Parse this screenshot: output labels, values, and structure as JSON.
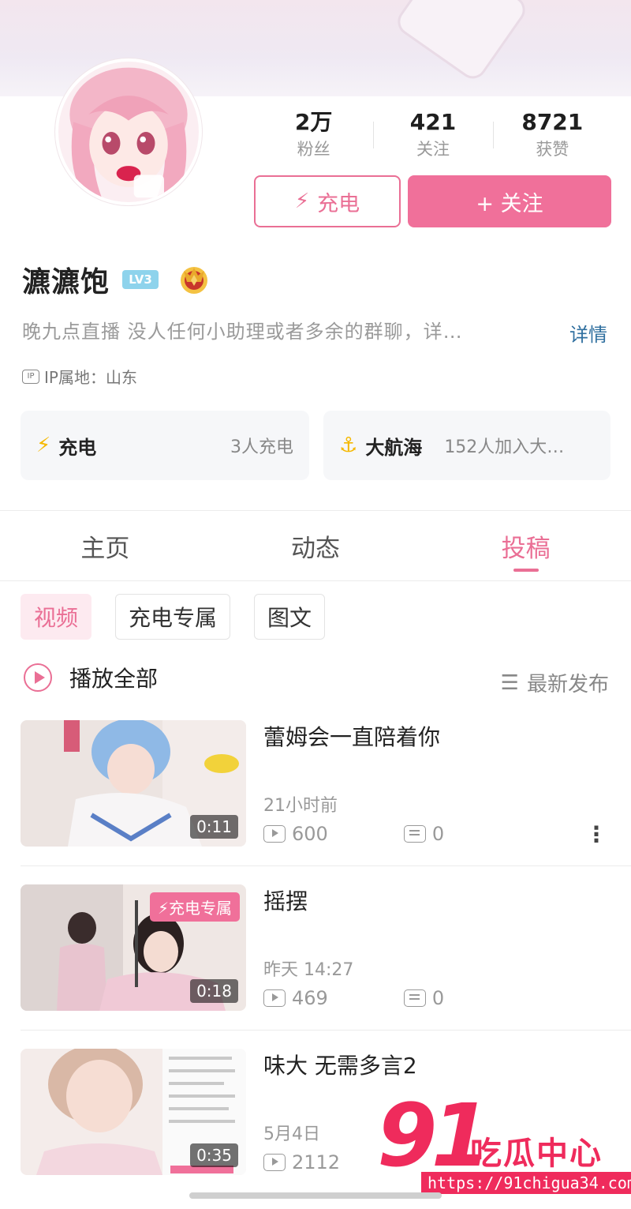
{
  "profile": {
    "name": "瀌瀌饱",
    "level": "LV3",
    "bio": "晚九点直播   没人任何小助理或者多余的群聊，详…",
    "bio_more": "详情",
    "ip_badge": "IP",
    "ip_location": "IP属地：山东"
  },
  "stats": [
    {
      "value": "2万",
      "label": "粉丝"
    },
    {
      "value": "421",
      "label": "关注"
    },
    {
      "value": "8721",
      "label": "获赞"
    }
  ],
  "actions": {
    "charge_icon": "bolt-icon",
    "charge_label": "充电",
    "follow_icon": "plus-icon",
    "follow_label": "+ 关注"
  },
  "cards": [
    {
      "icon": "bolt-icon",
      "title": "充电",
      "value": "3人充电"
    },
    {
      "icon": "anchor-icon",
      "title": "大航海",
      "value": "152人加入大…"
    }
  ],
  "tabs": [
    {
      "label": "主页",
      "active": false
    },
    {
      "label": "动态",
      "active": false
    },
    {
      "label": "投稿",
      "active": true
    }
  ],
  "filters": [
    {
      "label": "视频",
      "active": true
    },
    {
      "label": "充电专属",
      "active": false
    },
    {
      "label": "图文",
      "active": false
    }
  ],
  "list_header": {
    "play_all": "播放全部",
    "sort_label": "最新发布"
  },
  "videos": [
    {
      "title": "蕾姆会一直陪着你",
      "time": "21小时前",
      "plays": "600",
      "comments": "0",
      "duration": "0:11",
      "badge": ""
    },
    {
      "title": "摇摆",
      "time": "昨天 14:27",
      "plays": "469",
      "comments": "0",
      "duration": "0:18",
      "badge": "⚡充电专属"
    },
    {
      "title": "味大 无需多言2",
      "time": "5月4日",
      "plays": "2112",
      "comments": "",
      "duration": "0:35",
      "badge": ""
    }
  ],
  "watermark": {
    "number": "91",
    "text": "吃瓜中心",
    "url": "https://91chigua34.com"
  },
  "colors": {
    "accent": "#f0709a",
    "accent_text": "#ea6f95",
    "link": "#2f6f9f",
    "watermark": "#ef2b5c"
  }
}
